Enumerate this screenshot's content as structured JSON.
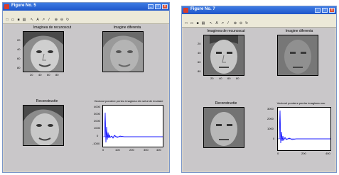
{
  "windows": [
    {
      "title": "Figure No. 5",
      "menu": [
        "File",
        "Edit",
        "View",
        "Insert",
        "Tools",
        "Window",
        "Help"
      ],
      "panels": {
        "recon": "Imaginea de recunoscut",
        "diff": "Imagine diferenta",
        "rebuild": "Reconstructie",
        "weights": "Vectorul pondere pentru imaginea din setul de invatare"
      },
      "img_ticks_y": [
        "20",
        "40",
        "60",
        "80"
      ],
      "img_ticks_x": [
        "20",
        "40",
        "60",
        "80"
      ],
      "plot_y_ticks": [
        "4000",
        "3000",
        "2000",
        "1000",
        "0",
        "-1000"
      ],
      "plot_x_ticks": [
        "0",
        "100",
        "200",
        "300",
        "400"
      ]
    },
    {
      "title": "Figure No. 7",
      "menu": [
        "File",
        "Edit",
        "View",
        "Insert",
        "Tools",
        "Window",
        "Help"
      ],
      "panels": {
        "recon": "Imaginea de recunoscut",
        "diff": "Imagine diferenta",
        "rebuild": "Reconstructie",
        "weights": "Vectorul pondere pentru imaginea nou"
      },
      "img_ticks_y": [
        "20",
        "40",
        "60",
        "80"
      ],
      "img_ticks_x": [
        "20",
        "40",
        "60",
        "80"
      ],
      "plot_y_ticks": [
        "3000",
        "2000",
        "1000",
        "0"
      ],
      "plot_x_ticks": [
        "0",
        "200",
        "400"
      ]
    }
  ],
  "icons": [
    "new-file-icon",
    "open-icon",
    "save-icon",
    "print-icon",
    "arrow-icon",
    "text-icon",
    "arrow-annot-icon",
    "line-icon",
    "zoom-in-icon",
    "zoom-out-icon",
    "rotate-icon"
  ],
  "colors": {
    "title_bar": "#1e55c9",
    "figure_bg": "#c9c7c9",
    "plot_line": "#0000ff"
  }
}
